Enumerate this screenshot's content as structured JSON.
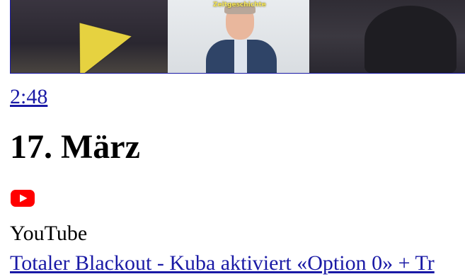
{
  "video": {
    "thumbnail_caption": "Zeitgeschichte",
    "duration": "2:48"
  },
  "date_heading": "17. März",
  "source": {
    "icon": "youtube-icon",
    "name": "YouTube",
    "brand_color": "#ff0000"
  },
  "article": {
    "title": "Totaler Blackout - Kuba aktiviert «Option 0» + Tr"
  },
  "colors": {
    "link": "#1a1aa6",
    "text": "#000000"
  }
}
